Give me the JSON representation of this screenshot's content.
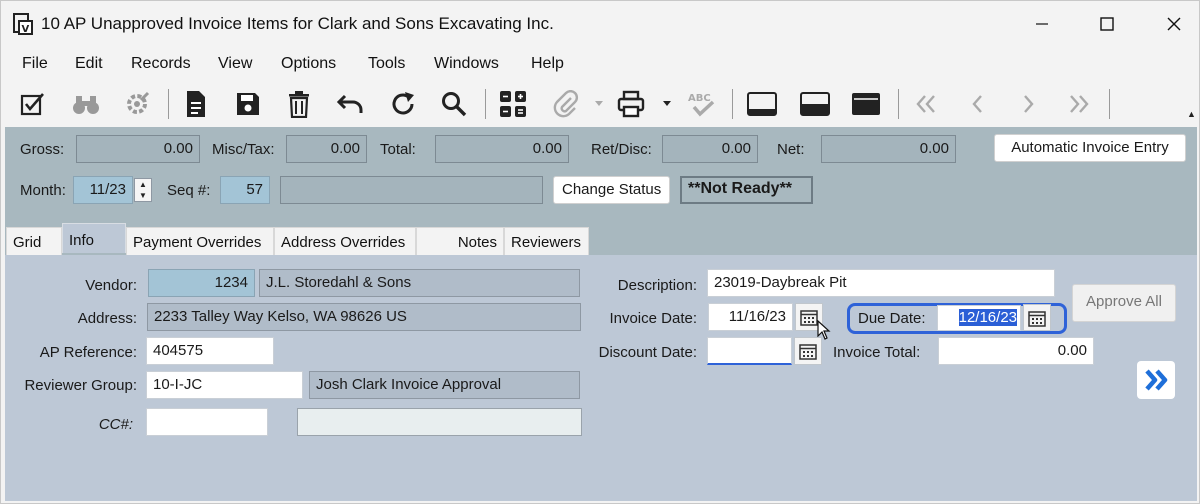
{
  "window": {
    "title": "10 AP Unapproved Invoice Items for Clark and Sons Excavating Inc.",
    "icons": [
      "app-invoice-icon",
      "minimize-icon",
      "maximize-icon",
      "close-icon"
    ]
  },
  "menu": [
    "File",
    "Edit",
    "Records",
    "View",
    "Options",
    "Tools",
    "Windows",
    "Help"
  ],
  "toolbar": {
    "icons": [
      "edit-check-icon",
      "binoculars-icon",
      "settings-wrench-icon",
      "document-icon",
      "save-icon",
      "delete-icon",
      "undo-icon",
      "refresh-icon",
      "search-icon",
      "grid-icon",
      "attach-icon",
      "print-icon",
      "spellcheck-icon",
      "layout-top-icon",
      "layout-split-icon",
      "layout-full-icon",
      "first-record-icon",
      "prev-record-icon",
      "next-record-icon",
      "last-record-icon"
    ]
  },
  "header": {
    "gross_label": "Gross:",
    "gross_value": "0.00",
    "misc_tax_label": "Misc/Tax:",
    "misc_tax_value": "0.00",
    "total_label": "Total:",
    "total_value": "0.00",
    "ret_disc_label": "Ret/Disc:",
    "ret_disc_value": "0.00",
    "net_label": "Net:",
    "net_value": "0.00",
    "auto_invoice_button": "Automatic Invoice Entry",
    "month_label": "Month:",
    "month_value": "11/23",
    "seq_label": "Seq #:",
    "seq_value": "57",
    "seq_desc": "",
    "change_status_button": "Change Status",
    "status_text": "**Not Ready**"
  },
  "tabs": [
    {
      "label": "Grid",
      "active": false
    },
    {
      "label": "Info",
      "active": true
    },
    {
      "label": "Payment Overrides",
      "active": false
    },
    {
      "label": "Address Overrides",
      "active": false
    },
    {
      "label": "Notes",
      "active": false
    },
    {
      "label": "Reviewers",
      "active": false
    }
  ],
  "info": {
    "vendor_label": "Vendor:",
    "vendor_id": "1234",
    "vendor_name": "J.L. Storedahl & Sons",
    "address_label": "Address:",
    "address_value": "2233 Talley Way  Kelso, WA  98626  US",
    "ap_reference_label": "AP Reference:",
    "ap_reference_value": "404575",
    "reviewer_group_label": "Reviewer Group:",
    "reviewer_group_value": "10-I-JC",
    "reviewer_group_desc": "Josh Clark Invoice Approval",
    "cc_label": "CC#:",
    "cc_value": "",
    "cc_desc": "",
    "description_label": "Description:",
    "description_value": "23019-Daybreak Pit",
    "invoice_date_label": "Invoice Date:",
    "invoice_date_value": "11/16/23",
    "due_date_label": "Due Date:",
    "due_date_value": "12/16/23",
    "discount_date_label": "Discount Date:",
    "discount_date_value": "",
    "invoice_total_label": "Invoice Total:",
    "invoice_total_value": "0.00",
    "approve_all_button": "Approve All"
  },
  "colors": {
    "header_bg": "#a8b8bf",
    "content_bg": "#bdc8d6",
    "highlight": "#2e62d8",
    "selection": "#2b5fd6",
    "next_arrow": "#1e6fd9"
  }
}
